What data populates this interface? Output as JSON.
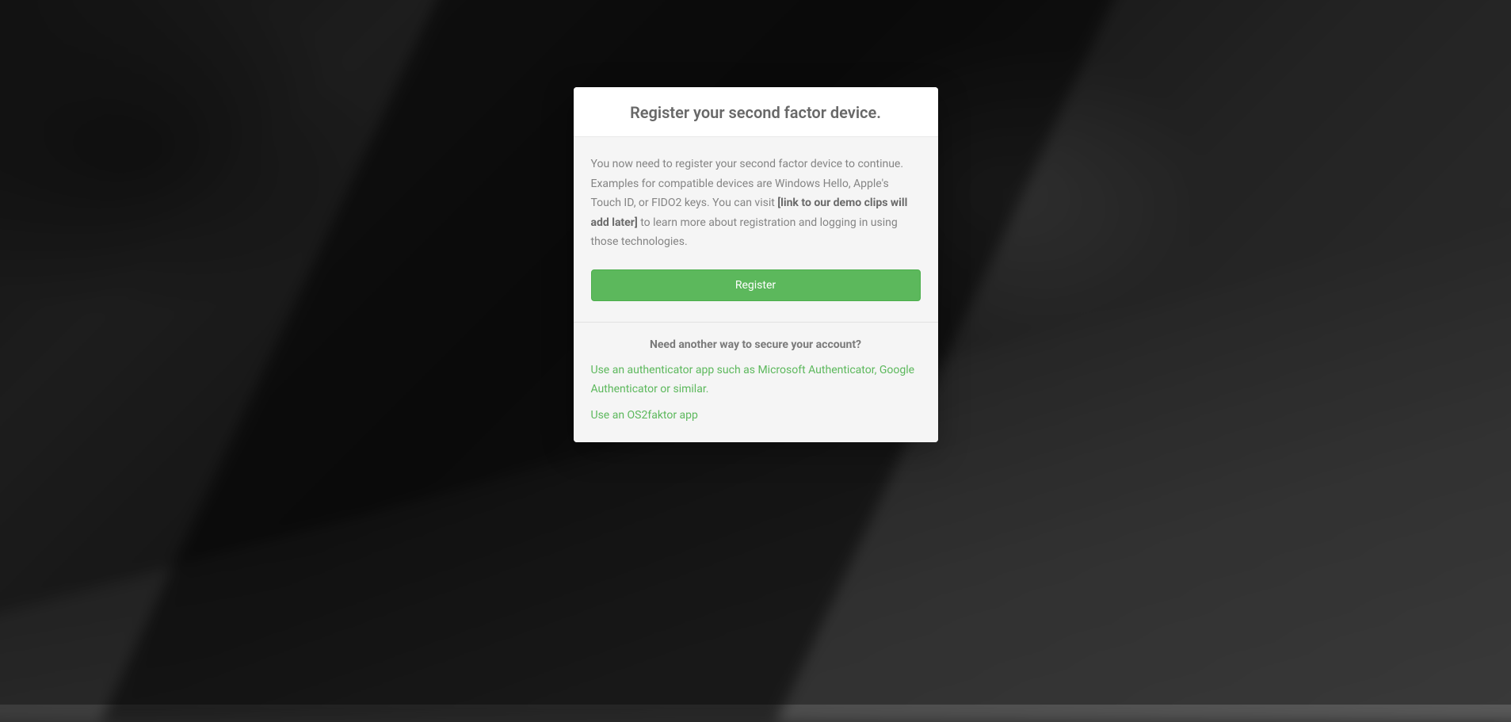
{
  "modal": {
    "title": "Register your second factor device.",
    "description": {
      "text_before": "You now need to register your second factor device to continue. Examples for compatible devices are Windows Hello, Apple's Touch ID, or FIDO2 keys. You can visit ",
      "bold_text": "[link to our demo clips will add later]",
      "text_after": " to learn more about registration and logging in using those technologies."
    },
    "register_button_label": "Register",
    "footer": {
      "heading": "Need another way to secure your account?",
      "links": [
        "Use an authenticator app such as Microsoft Authenticator, Google Authenticator or similar.",
        "Use an OS2faktor app"
      ]
    }
  }
}
